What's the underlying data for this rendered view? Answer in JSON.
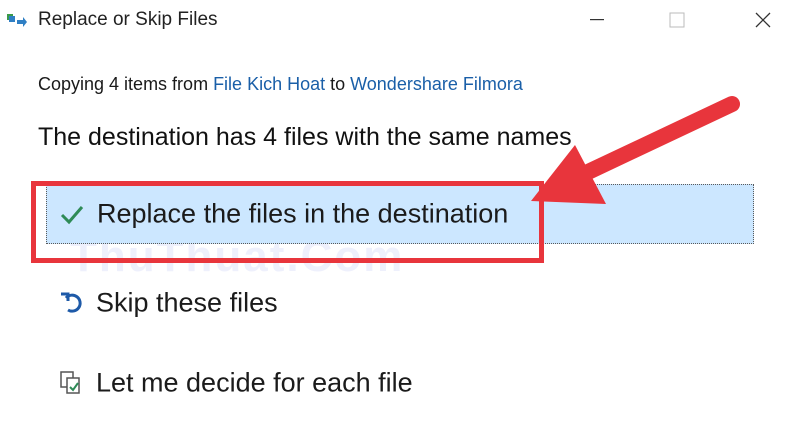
{
  "window": {
    "title": "Replace or Skip Files"
  },
  "copy": {
    "prefix": "Copying 4 items from ",
    "source": "File Kich Hoat",
    "to": " to ",
    "destination": "Wondershare Filmora"
  },
  "heading": "The destination has 4 files with the same names",
  "options": [
    {
      "label": "Replace the files in the destination",
      "icon": "checkmark-icon",
      "selected": true
    },
    {
      "label": "Skip these files",
      "icon": "skip-arrow-icon",
      "selected": false
    },
    {
      "label": "Let me decide for each file",
      "icon": "compare-files-icon",
      "selected": false
    }
  ],
  "watermark": "ThuThuat.Com",
  "colors": {
    "accent": "#1a5fa8",
    "selected_bg": "#cce7ff",
    "annotation": "#e8353c",
    "check": "#2e8b57"
  }
}
